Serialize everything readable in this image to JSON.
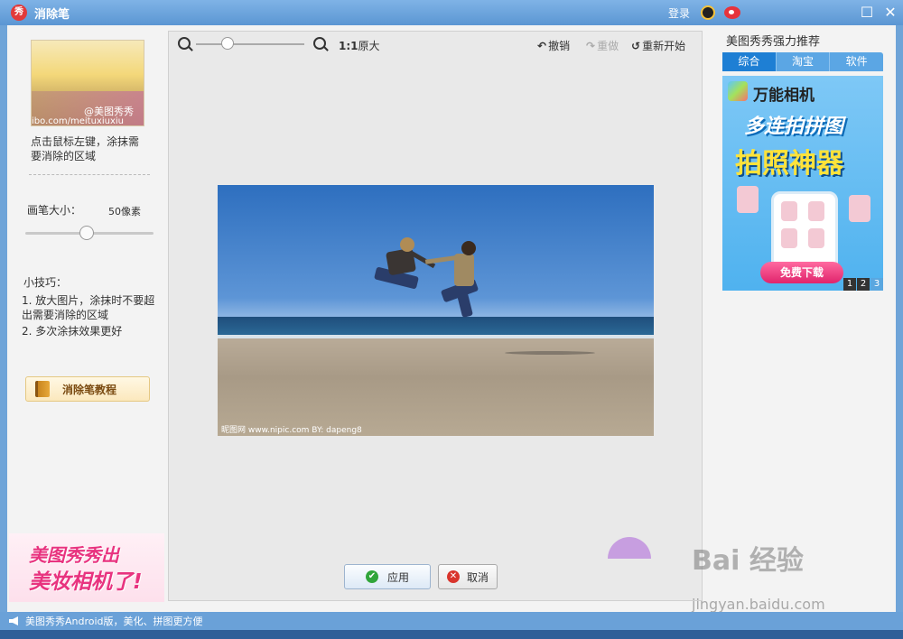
{
  "window": {
    "logo_text": "秀",
    "title": "消除笔",
    "login": "登录",
    "minimize": "☐",
    "close": "✕"
  },
  "left": {
    "thumb_watermark1": "@美图秀秀",
    "thumb_watermark2": "ibo.com/meituxiuxiu",
    "instruction": "点击鼠标左键，涂抹需要消除的区域",
    "brush_label": "画笔大小：",
    "brush_value": "50像素",
    "brush_level": 0.5,
    "tips_title": "小技巧：",
    "tips": [
      "1. 放大图片，涂抹时不要超出需要消除的区域",
      "2. 多次涂抹效果更好"
    ],
    "tutorial_button": "消除笔教程",
    "promo_line1": "美图秀秀出",
    "promo_line2": "美妆相机了!"
  },
  "toolbar": {
    "actual_size_prefix": "1:1",
    "actual_size": "原大",
    "undo": "撤销",
    "redo": "重做",
    "restart": "重新开始",
    "zoom_level": 0.25
  },
  "photo": {
    "watermark": "昵图网 www.nipic.com    BY: dapeng8"
  },
  "actions": {
    "apply": "应用",
    "cancel": "取消"
  },
  "right": {
    "title": "美图秀秀强力推荐",
    "tabs": [
      "综合",
      "淘宝",
      "软件"
    ],
    "active_tab": 0,
    "ad_title": "万能相机",
    "ad_line1": "多连拍拼图",
    "ad_line2": "拍照神器",
    "ad_button": "免费下载",
    "pages": [
      "1",
      "2",
      "3"
    ],
    "watermark_main": "Bai 经验",
    "watermark_url": "jingyan.baidu.com"
  },
  "status": {
    "text": "美图秀秀Android版，美化、拼图更方便"
  },
  "colors": {
    "titlebar": "#5b96d3",
    "tab_active": "#1e7fd4",
    "apply_icon": "#31a53a",
    "cancel_icon": "#d9352c",
    "promo_pink": "#e8337f"
  }
}
